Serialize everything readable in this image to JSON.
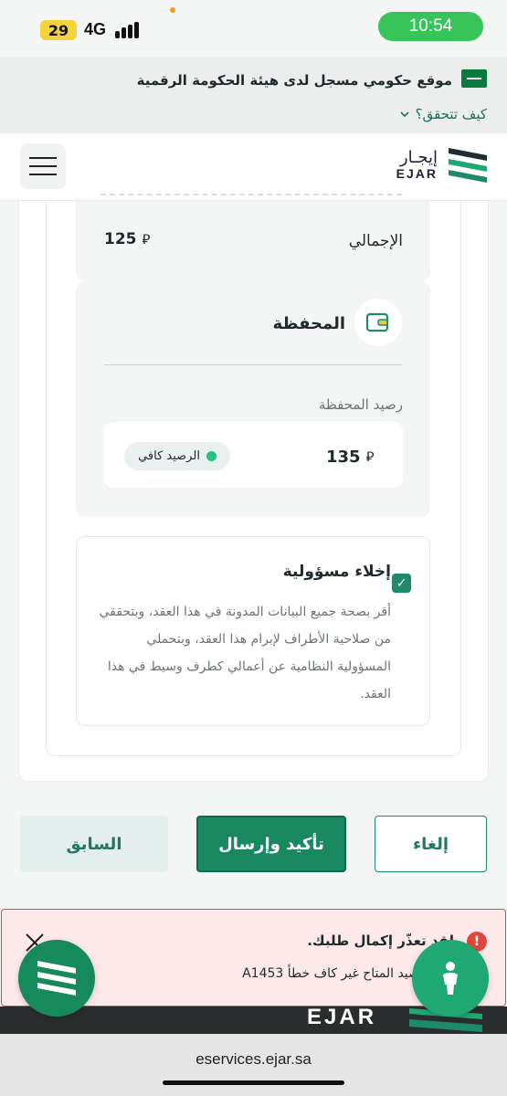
{
  "status_bar": {
    "battery": "29",
    "network": "4G",
    "time": "10:54"
  },
  "gov_banner": {
    "text": "موقع حكومي مسجل لدى هيئة الحكومة الرقمية",
    "verify_link": "كيف تتحقق؟"
  },
  "header": {
    "logo_ar": "إيجـار",
    "logo_en": "EJAR"
  },
  "summary": {
    "total_label": "الإجمالي",
    "total_value": "125"
  },
  "wallet": {
    "title": "المحفظة",
    "balance_label": "رصيد المحفظة",
    "balance_value": "135",
    "status": "الرصيد كافي"
  },
  "disclaimer": {
    "title": "إخلاء مسؤولية",
    "text": "أقر بصحة جميع البيانات المدونة في هذا العقد، وبتحققي من صلاحية الأطراف لإبرام هذا العقد، وبتحملي المسؤولية النظامية عن أعمالي كطرف وسيط في هذا العقد."
  },
  "actions": {
    "cancel": "إلغاء",
    "submit": "تأكيد وإرسال",
    "previous": "السابق"
  },
  "toast": {
    "title": "لقد تعذّر إكمال طلبك.",
    "message": "E1 الرصيد المتاح غير كاف خطأ A1453"
  },
  "footer": {
    "logo": "EJAR"
  },
  "browser": {
    "url": "eservices.ejar.sa"
  },
  "colors": {
    "brand_green": "#198760",
    "error_red": "#d9485a",
    "success_dot": "#26c281"
  }
}
